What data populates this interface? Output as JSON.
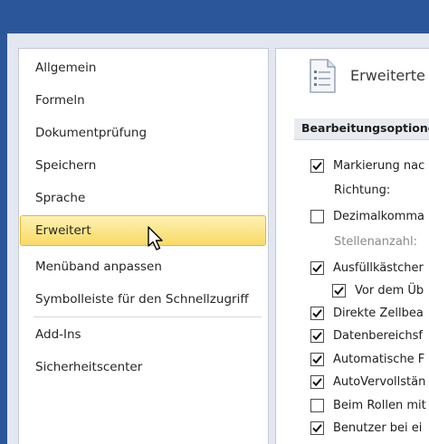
{
  "nav": {
    "items": [
      {
        "label": "Allgemein"
      },
      {
        "label": "Formeln"
      },
      {
        "label": "Dokumentprüfung"
      },
      {
        "label": "Speichern"
      },
      {
        "label": "Sprache"
      },
      {
        "label": "Erweitert",
        "selected": true
      },
      {
        "label": "Menüband anpassen"
      },
      {
        "label": "Symbolleiste für den Schnellzugriff"
      },
      {
        "label": "Add-Ins"
      },
      {
        "label": "Sicherheitscenter"
      }
    ]
  },
  "content": {
    "page_title": "Erweiterte",
    "page_icon": "advanced-options-icon",
    "section_title": "Bearbeitungsoptione",
    "options": [
      {
        "label": "Markierung nac",
        "type": "checkbox",
        "checked": true
      },
      {
        "label": "Richtung:",
        "type": "label"
      },
      {
        "label": "Dezimalkomma",
        "type": "checkbox",
        "checked": false
      },
      {
        "label": "Stellenanzahl:",
        "type": "label",
        "disabled": true
      },
      {
        "label": "Ausfüllkästcher",
        "type": "checkbox",
        "checked": true
      },
      {
        "label": "Vor dem Üb",
        "type": "checkbox",
        "checked": true
      },
      {
        "label": "Direkte Zellbea",
        "type": "checkbox",
        "checked": true
      },
      {
        "label": "Datenbereichsf",
        "type": "checkbox",
        "checked": true
      },
      {
        "label": "Automatische F",
        "type": "checkbox",
        "checked": true
      },
      {
        "label": "AutoVervollstän",
        "type": "checkbox",
        "checked": true
      },
      {
        "label": "Beim Rollen mit",
        "type": "checkbox",
        "checked": false
      },
      {
        "label": "Benutzer bei ei",
        "type": "checkbox",
        "checked": true
      }
    ]
  },
  "colors": {
    "title_bar": "#2b579a",
    "selected_nav_top": "#fdf1b3",
    "selected_nav_bottom": "#f9da66"
  },
  "cursor_icon": "arrow-cursor-icon"
}
